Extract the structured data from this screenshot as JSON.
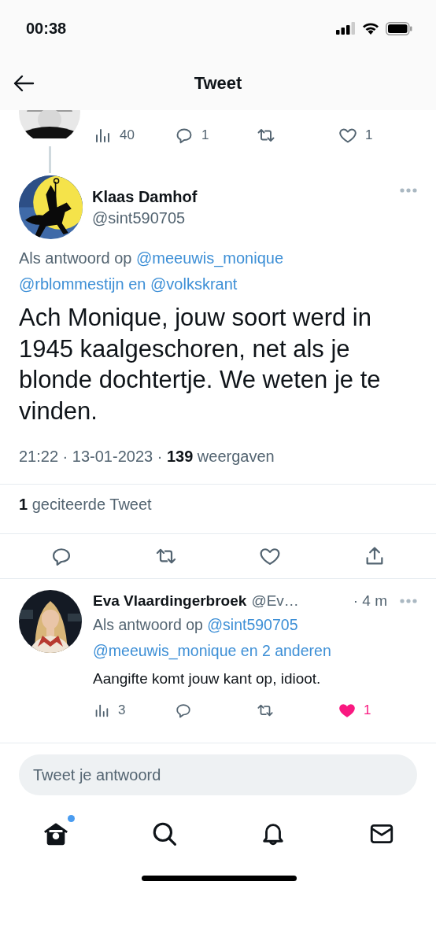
{
  "status_bar": {
    "time": "00:38"
  },
  "header": {
    "title": "Tweet"
  },
  "previous_tweet": {
    "stats": [
      {
        "kind": "views",
        "count": "40"
      },
      {
        "kind": "reply",
        "count": "1"
      },
      {
        "kind": "retweet"
      },
      {
        "kind": "like",
        "count": "1",
        "liked": false
      }
    ]
  },
  "tweet": {
    "name": "Klaas Damhof",
    "handle": "@sint590705",
    "reply_to": {
      "prefix": "Als antwoord op",
      "mentions": [
        "@meeuwis_monique",
        "@rblommestijn en @volkskrant"
      ]
    },
    "text": "Ach Monique, jouw soort werd in 1945 kaalgeschoren, net als je blonde dochtertje. We weten je te vinden.",
    "meta": "21:22 · 13-01-2023 · **139** weergaven",
    "quotes": "**1** geciteerde Tweet",
    "actions": [
      {
        "kind": "reply"
      },
      {
        "kind": "retweet"
      },
      {
        "kind": "like",
        "liked": false
      },
      {
        "kind": "share"
      }
    ]
  },
  "reply": {
    "name": "Eva Vlaardingerbroek",
    "handle": "@Ev…",
    "time": "· 4 m",
    "reply_to": {
      "prefix": "Als antwoord op",
      "mentions": [
        "@sint590705",
        "@meeuwis_monique en 2 anderen"
      ]
    },
    "text": "Aangifte komt jouw kant op, idioot.",
    "stats": [
      {
        "kind": "views",
        "count": "3"
      },
      {
        "kind": "reply"
      },
      {
        "kind": "retweet"
      },
      {
        "kind": "like",
        "count": "1",
        "liked": true
      }
    ]
  },
  "reply_box": {
    "placeholder": "Tweet je antwoord"
  },
  "tab_bar": {
    "tabs": [
      {
        "kind": "home",
        "selected": true,
        "badge": true
      },
      {
        "kind": "search",
        "selected": false,
        "badge": false
      },
      {
        "kind": "notifications",
        "selected": false,
        "badge": false
      },
      {
        "kind": "messages",
        "selected": false,
        "badge": false
      }
    ]
  }
}
